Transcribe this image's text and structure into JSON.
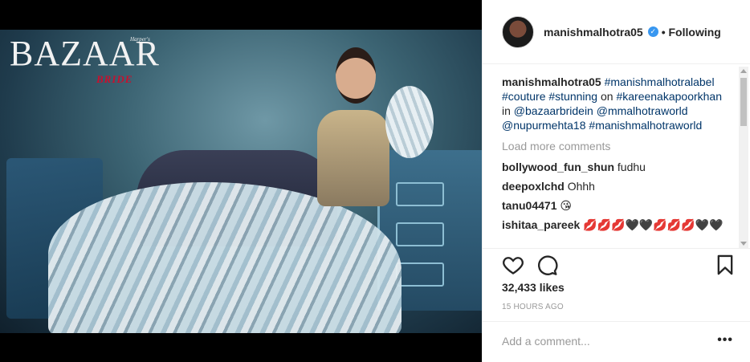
{
  "magazine": {
    "super": "Harper's",
    "title": "BAZAAR",
    "sub": "BRIDE"
  },
  "post": {
    "username": "manishmalhotra05",
    "follow_label": "• Following",
    "caption": {
      "user": "manishmalhotra05",
      "t1": "#manishmalhotralabel",
      "t2": "#couture",
      "t3": "#stunning",
      "on": " on ",
      "t4": "#kareenakapoorkhan",
      "in": " in ",
      "t5": "@bazaarbridein",
      "t6": "@mmalhotraworld",
      "t7": "@nupurmehta18",
      "t8": "#manishmalhotraworld"
    },
    "load_more": "Load more comments",
    "comments": [
      {
        "user": "bollywood_fun_shun",
        "text": "fudhu"
      },
      {
        "user": "deepoxlchd",
        "text": "Ohhh"
      },
      {
        "user": "tanu04471",
        "text": "😘"
      },
      {
        "user": "ishitaa_pareek",
        "text": "💋💋💋🖤🖤💋💋💋🖤🖤"
      }
    ],
    "likes": "32,433 likes",
    "time": "15 HOURS AGO",
    "add_comment_placeholder": "Add a comment...",
    "more_label": "•••"
  },
  "icons": {
    "heart": "heart-icon",
    "comment": "comment-icon",
    "save": "bookmark-icon",
    "verified": "verified-badge-icon"
  },
  "colors": {
    "link": "#003569",
    "verified": "#3897f0",
    "muted": "#999999",
    "text": "#262626"
  }
}
